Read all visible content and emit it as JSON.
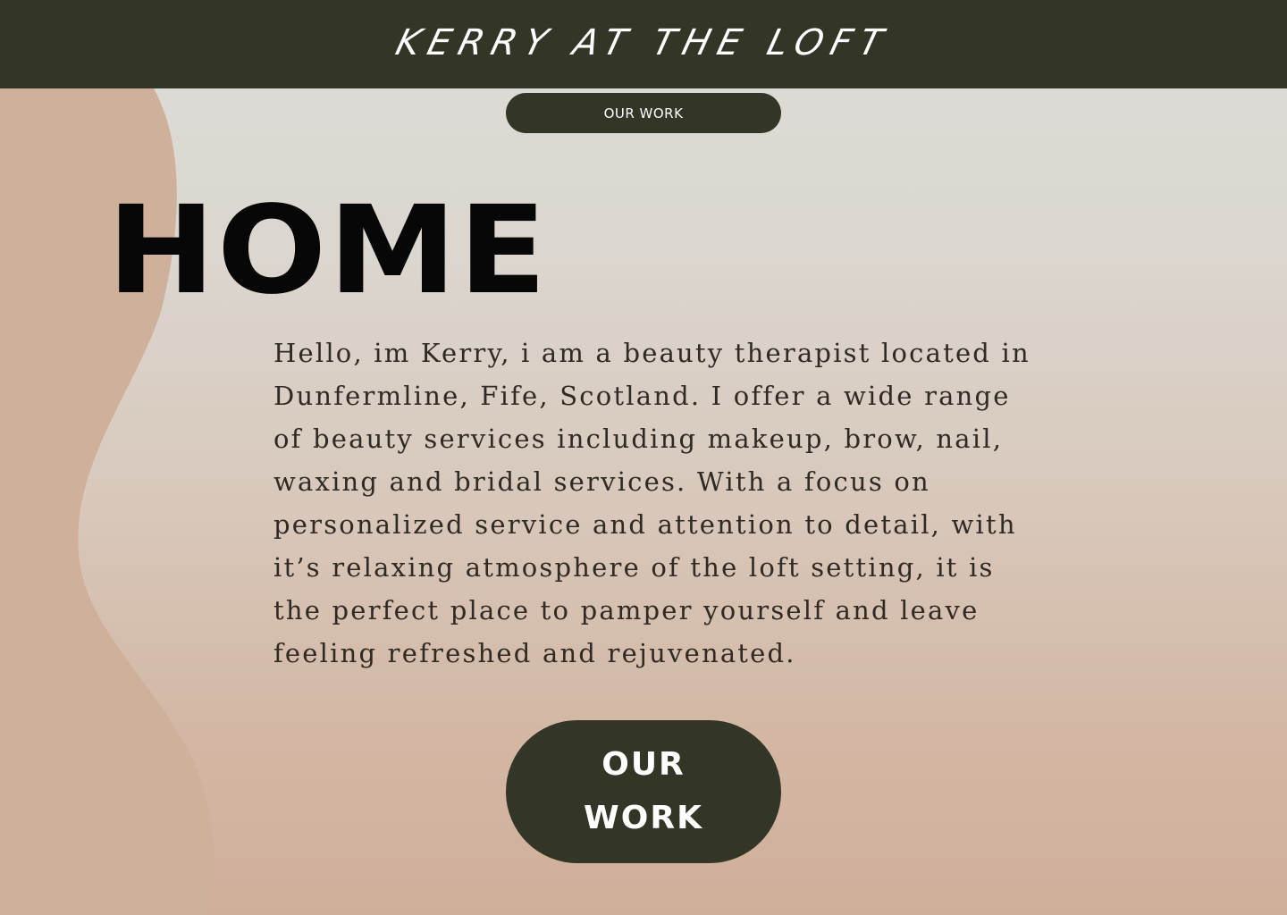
{
  "header": {
    "brand": "KERRY AT THE LOFT"
  },
  "nav": {
    "our_work_label": "OUR WORK"
  },
  "main": {
    "title": "HOME",
    "intro": "Hello, im Kerry, i am a beauty therapist located in Dunfermline, Fife, Scotland. I offer a wide range of beauty services including makeup, brow, nail, waxing and bridal services. With a focus on personalized service and attention to detail, with it’s relaxing atmosphere of the loft setting, it is the perfect place to pamper yourself and leave feeling refreshed and rejuvenated.",
    "cta_label": "OUR WORK"
  },
  "colors": {
    "header_bg": "#333526",
    "button_bg": "#333526",
    "accent_wave": "#cfb09b",
    "text_dark": "#2f2a24"
  }
}
